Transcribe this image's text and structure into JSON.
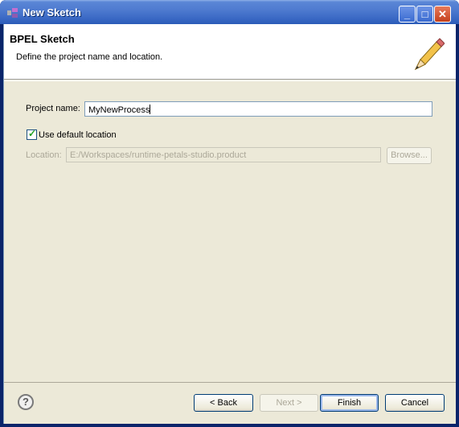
{
  "window": {
    "title": "New Sketch",
    "controls": [
      "minimize-icon",
      "maximize-icon",
      "close-icon"
    ]
  },
  "header": {
    "title": "BPEL Sketch",
    "description": "Define the project name and location.",
    "image": "pencil-icon"
  },
  "form": {
    "project_name_label": "Project name:",
    "project_name_value": "MyNewProcess",
    "use_default_label": "Use default location",
    "use_default_checked": true,
    "location_label": "Location:",
    "location_value": "E:/Workspaces/runtime-petals-studio.product",
    "browse_label": "Browse..."
  },
  "footer": {
    "help_icon": "help-icon",
    "back_label": "< Back",
    "next_label": "Next >",
    "finish_label": "Finish",
    "cancel_label": "Cancel"
  },
  "colors": {
    "titlebar": "#3e6cc7",
    "dialog_bg": "#ece9d8",
    "disabled_text": "#aca899"
  }
}
